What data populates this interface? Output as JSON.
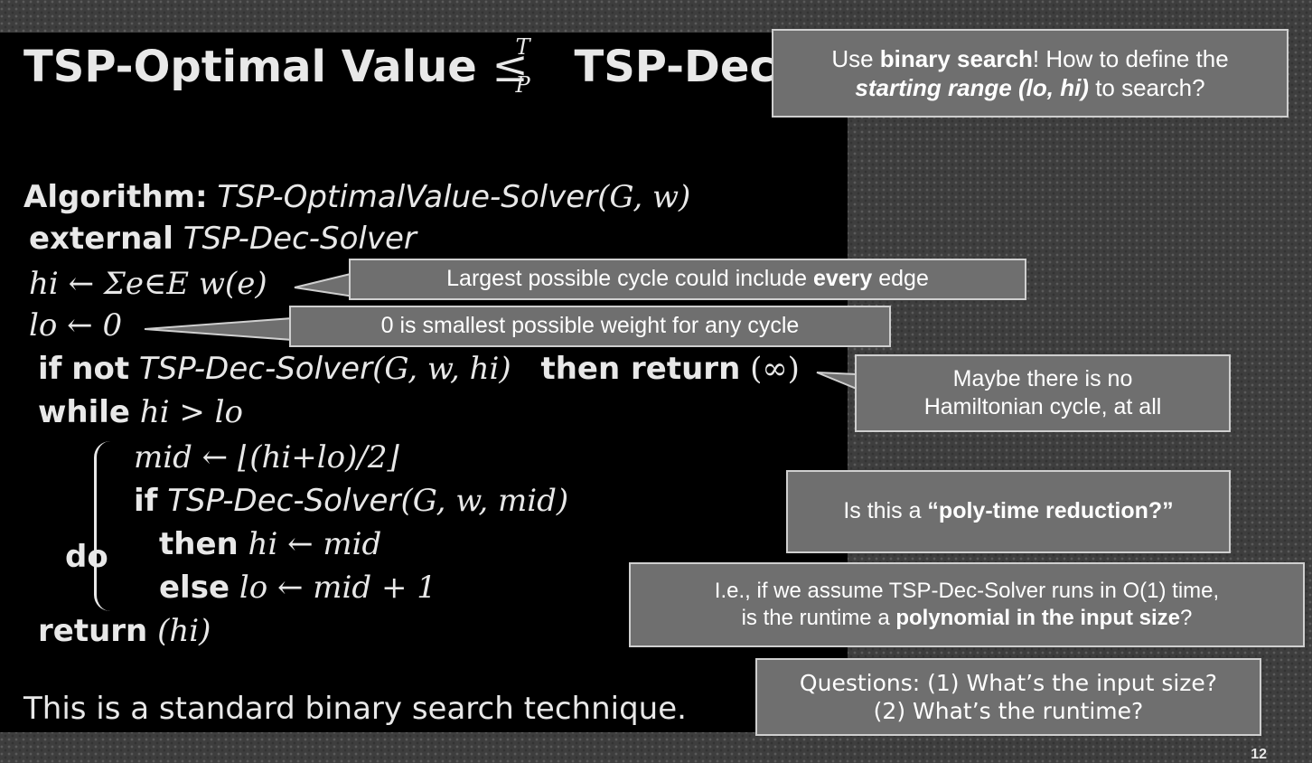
{
  "title": {
    "left": "TSP-Optimal Value",
    "rel_sup": "T",
    "rel_sub": "P",
    "right": "TSP-Dec"
  },
  "algorithm": {
    "label": "Algorithm:",
    "name": "TSP-OptimalValue-Solver",
    "params": "(G, w)",
    "external_kw": "external",
    "external_name": "TSP-Dec-Solver",
    "hi_line": "hi ← Σe∈E w(e)",
    "lo_line": "lo ← 0",
    "if_kw": "if",
    "not_kw": "not",
    "if_call": "TSP-Dec-Solver",
    "if_args": "(G, w, hi)",
    "then_return_kw": "then return",
    "infinity": "(∞)",
    "while_kw": "while",
    "while_cond": "hi > lo",
    "do_kw": "do",
    "mid_line": "mid ← ⌊(hi+lo)/2⌋",
    "inner_if_kw": "if",
    "inner_call": "TSP-Dec-Solver",
    "inner_args": "(G, w, mid)",
    "then_kw": "then",
    "then_expr": "hi ← mid",
    "else_kw": "else",
    "else_expr": "lo ← mid + 1",
    "return_kw": "return",
    "return_expr": "(hi)"
  },
  "footer_text": "This is a standard binary search technique.",
  "callouts": {
    "binary_search": {
      "pre": "Use ",
      "bold": "binary search",
      "mid": "! How to define the",
      "bold_italic": "starting range (lo, hi)",
      "post": " to search?"
    },
    "largest_cycle": {
      "pre": "Largest possible cycle could include ",
      "bold": "every",
      "post": " edge"
    },
    "smallest_weight": {
      "text": "0 is smallest possible weight for any cycle"
    },
    "no_cycle": {
      "line1": "Maybe there is no",
      "line2": "Hamiltonian cycle, at all"
    },
    "poly_time": {
      "pre": "Is this a ",
      "bold": "“poly-time reduction?”"
    },
    "runtime": {
      "line1": "I.e., if we assume TSP-Dec-Solver runs in O(1) time,",
      "pre": "is the runtime a ",
      "bold": "polynomial in the input size",
      "post": "?"
    },
    "questions": {
      "line1": "Questions: (1) What’s the input size?",
      "line2": "(2) What’s the runtime?"
    }
  },
  "page_number": "12",
  "colors": {
    "panel": "#000000",
    "callout_fill": "#6f6f6f",
    "callout_border": "#cfcfcf",
    "text": "#e8e8e8"
  }
}
